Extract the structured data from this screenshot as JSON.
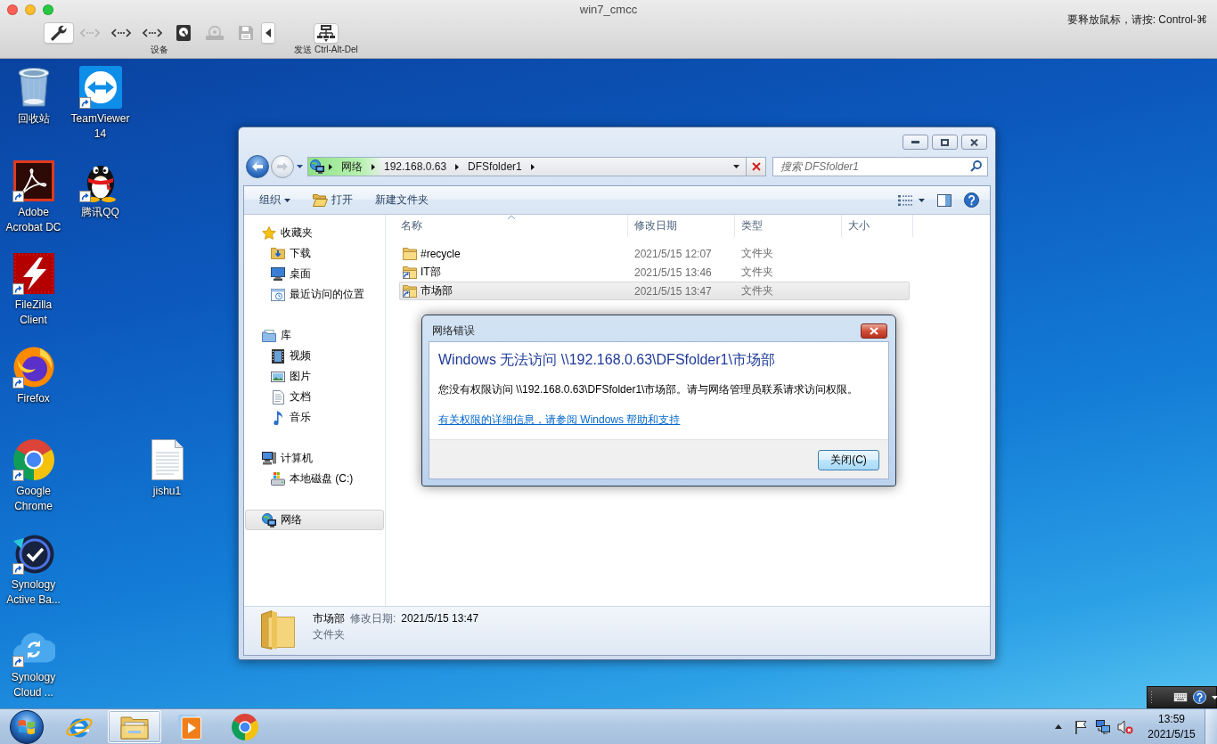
{
  "host_window": {
    "title": "win7_cmcc",
    "release_hint": "要释放鼠标，请按: Control-⌘",
    "devices": {
      "label": "设备",
      "items": [
        {
          "kind": "settings",
          "disabled": false
        },
        {
          "kind": "network",
          "disabled": true
        },
        {
          "kind": "network",
          "disabled": false
        },
        {
          "kind": "network",
          "disabled": false
        },
        {
          "kind": "hard-disk",
          "disabled": false
        },
        {
          "kind": "optical",
          "disabled": true
        },
        {
          "kind": "floppy",
          "disabled": true
        },
        {
          "kind": "collapse",
          "disabled": false
        }
      ]
    },
    "send_keys": {
      "label": "发送 Ctrl-Alt-Del"
    }
  },
  "desktop": {
    "icons": [
      {
        "label": "回收站",
        "kind": "recycle-bin",
        "shortcut": false
      },
      {
        "label": "TeamViewer 14",
        "kind": "remote",
        "shortcut": true
      },
      {
        "label": "Adobe Acrobat DC",
        "kind": "pdf",
        "shortcut": true
      },
      {
        "label": "腾讯QQ",
        "kind": "penguin",
        "shortcut": true
      },
      {
        "label": "FileZilla Client",
        "kind": "ftp",
        "shortcut": true
      },
      {
        "label": "Firefox",
        "kind": "fox",
        "shortcut": true
      },
      {
        "label": "Google Chrome",
        "kind": "chrome",
        "shortcut": true
      },
      {
        "label": "jishu1",
        "kind": "text-file",
        "shortcut": false
      },
      {
        "label": "Synology Active Ba...",
        "kind": "backup",
        "shortcut": true
      },
      {
        "label": "Synology Cloud ...",
        "kind": "cloud",
        "shortcut": true
      }
    ]
  },
  "explorer": {
    "back": {
      "disabled": false
    },
    "forward": {
      "disabled": true
    },
    "address": {
      "segments": [
        "网络",
        "192.168.0.63",
        "DFSfolder1"
      ],
      "level": 0.17
    },
    "search": {
      "placeholder": "搜索 DFSfolder1"
    },
    "commands": [
      {
        "label": "组织",
        "kind": "menu"
      },
      {
        "label": "打开",
        "kind": "open"
      },
      {
        "label": "新建文件夹",
        "kind": "plain"
      }
    ],
    "nav": [
      {
        "label": "收藏夹",
        "kind": "favorites",
        "selected": false,
        "children": [
          {
            "label": "下载",
            "kind": "downloads",
            "selected": false
          },
          {
            "label": "桌面",
            "kind": "desktop",
            "selected": false
          },
          {
            "label": "最近访问的位置",
            "kind": "recent",
            "selected": false
          }
        ]
      },
      {
        "label": "库",
        "kind": "libraries",
        "selected": false,
        "children": [
          {
            "label": "视频",
            "kind": "videos",
            "selected": false
          },
          {
            "label": "图片",
            "kind": "pictures",
            "selected": false
          },
          {
            "label": "文档",
            "kind": "documents",
            "selected": false
          },
          {
            "label": "音乐",
            "kind": "music",
            "selected": false
          }
        ]
      },
      {
        "label": "计算机",
        "kind": "computer",
        "selected": false,
        "children": [
          {
            "label": "本地磁盘 (C:)",
            "kind": "drive",
            "selected": false
          }
        ]
      },
      {
        "label": "网络",
        "kind": "network",
        "selected": true
      }
    ],
    "columns": [
      {
        "label": "名称",
        "sorted": true
      },
      {
        "label": "修改日期",
        "sorted": false
      },
      {
        "label": "类型",
        "sorted": false
      },
      {
        "label": "大小",
        "sorted": false
      }
    ],
    "rows": [
      {
        "name": "#recycle",
        "modified": "2021/5/15 12:07",
        "type": "文件夹",
        "kind": "folder",
        "selected": false
      },
      {
        "name": "IT部",
        "modified": "2021/5/15 13:46",
        "type": "文件夹",
        "kind": "link",
        "selected": false
      },
      {
        "name": "市场部",
        "modified": "2021/5/15 13:47",
        "type": "文件夹",
        "kind": "link",
        "selected": true
      }
    ],
    "details": {
      "name": "市场部",
      "modified_label": "修改日期:",
      "modified": "2021/5/15 13:47",
      "type": "文件夹"
    }
  },
  "dialog": {
    "title": "网络错误",
    "heading": "Windows 无法访问 \\\\192.168.0.63\\DFSfolder1\\市场部",
    "message": "您没有权限访问 \\\\192.168.0.63\\DFSfolder1\\市场部。请与网络管理员联系请求访问权限。",
    "link": "有关权限的详细信息，请参阅 Windows 帮助和支持",
    "buttons": [
      "关闭(C)"
    ]
  },
  "taskbar": {
    "apps": [
      {
        "kind": "ie",
        "selected": false
      },
      {
        "kind": "explorer",
        "selected": true
      },
      {
        "kind": "media",
        "selected": false
      },
      {
        "kind": "chrome",
        "selected": false
      }
    ],
    "tray": [
      {
        "kind": "show-hidden"
      },
      {
        "kind": "flag"
      },
      {
        "kind": "network"
      },
      {
        "kind": "volume",
        "muted": true
      }
    ],
    "time": "13:59",
    "date": "2021/5/15"
  }
}
